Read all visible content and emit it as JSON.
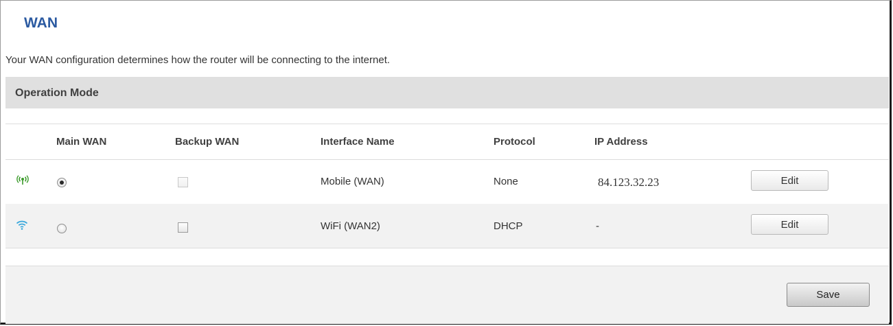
{
  "page": {
    "title": "WAN",
    "description": "Your WAN configuration determines how the router will be connecting to the internet."
  },
  "section": {
    "title": "Operation Mode"
  },
  "table": {
    "headers": {
      "main_wan": "Main WAN",
      "backup_wan": "Backup WAN",
      "interface_name": "Interface Name",
      "protocol": "Protocol",
      "ip_address": "IP Address"
    },
    "rows": [
      {
        "icon": "mobile-signal-icon",
        "icon_color": "#3a9a2a",
        "main_wan_selected": true,
        "backup_wan_checked": false,
        "backup_wan_enabled": false,
        "interface_name": "Mobile (WAN)",
        "protocol": "None",
        "ip_address": "84.123.32.23",
        "edit_label": "Edit"
      },
      {
        "icon": "wifi-icon",
        "icon_color": "#3aa8dc",
        "main_wan_selected": false,
        "backup_wan_checked": false,
        "backup_wan_enabled": true,
        "interface_name": "WiFi (WAN2)",
        "protocol": "DHCP",
        "ip_address": "-",
        "edit_label": "Edit"
      }
    ]
  },
  "footer": {
    "save_label": "Save"
  },
  "colors": {
    "title": "#2b5aa1",
    "section_bg": "#e0e0e0",
    "alt_row_bg": "#f2f2f2"
  }
}
